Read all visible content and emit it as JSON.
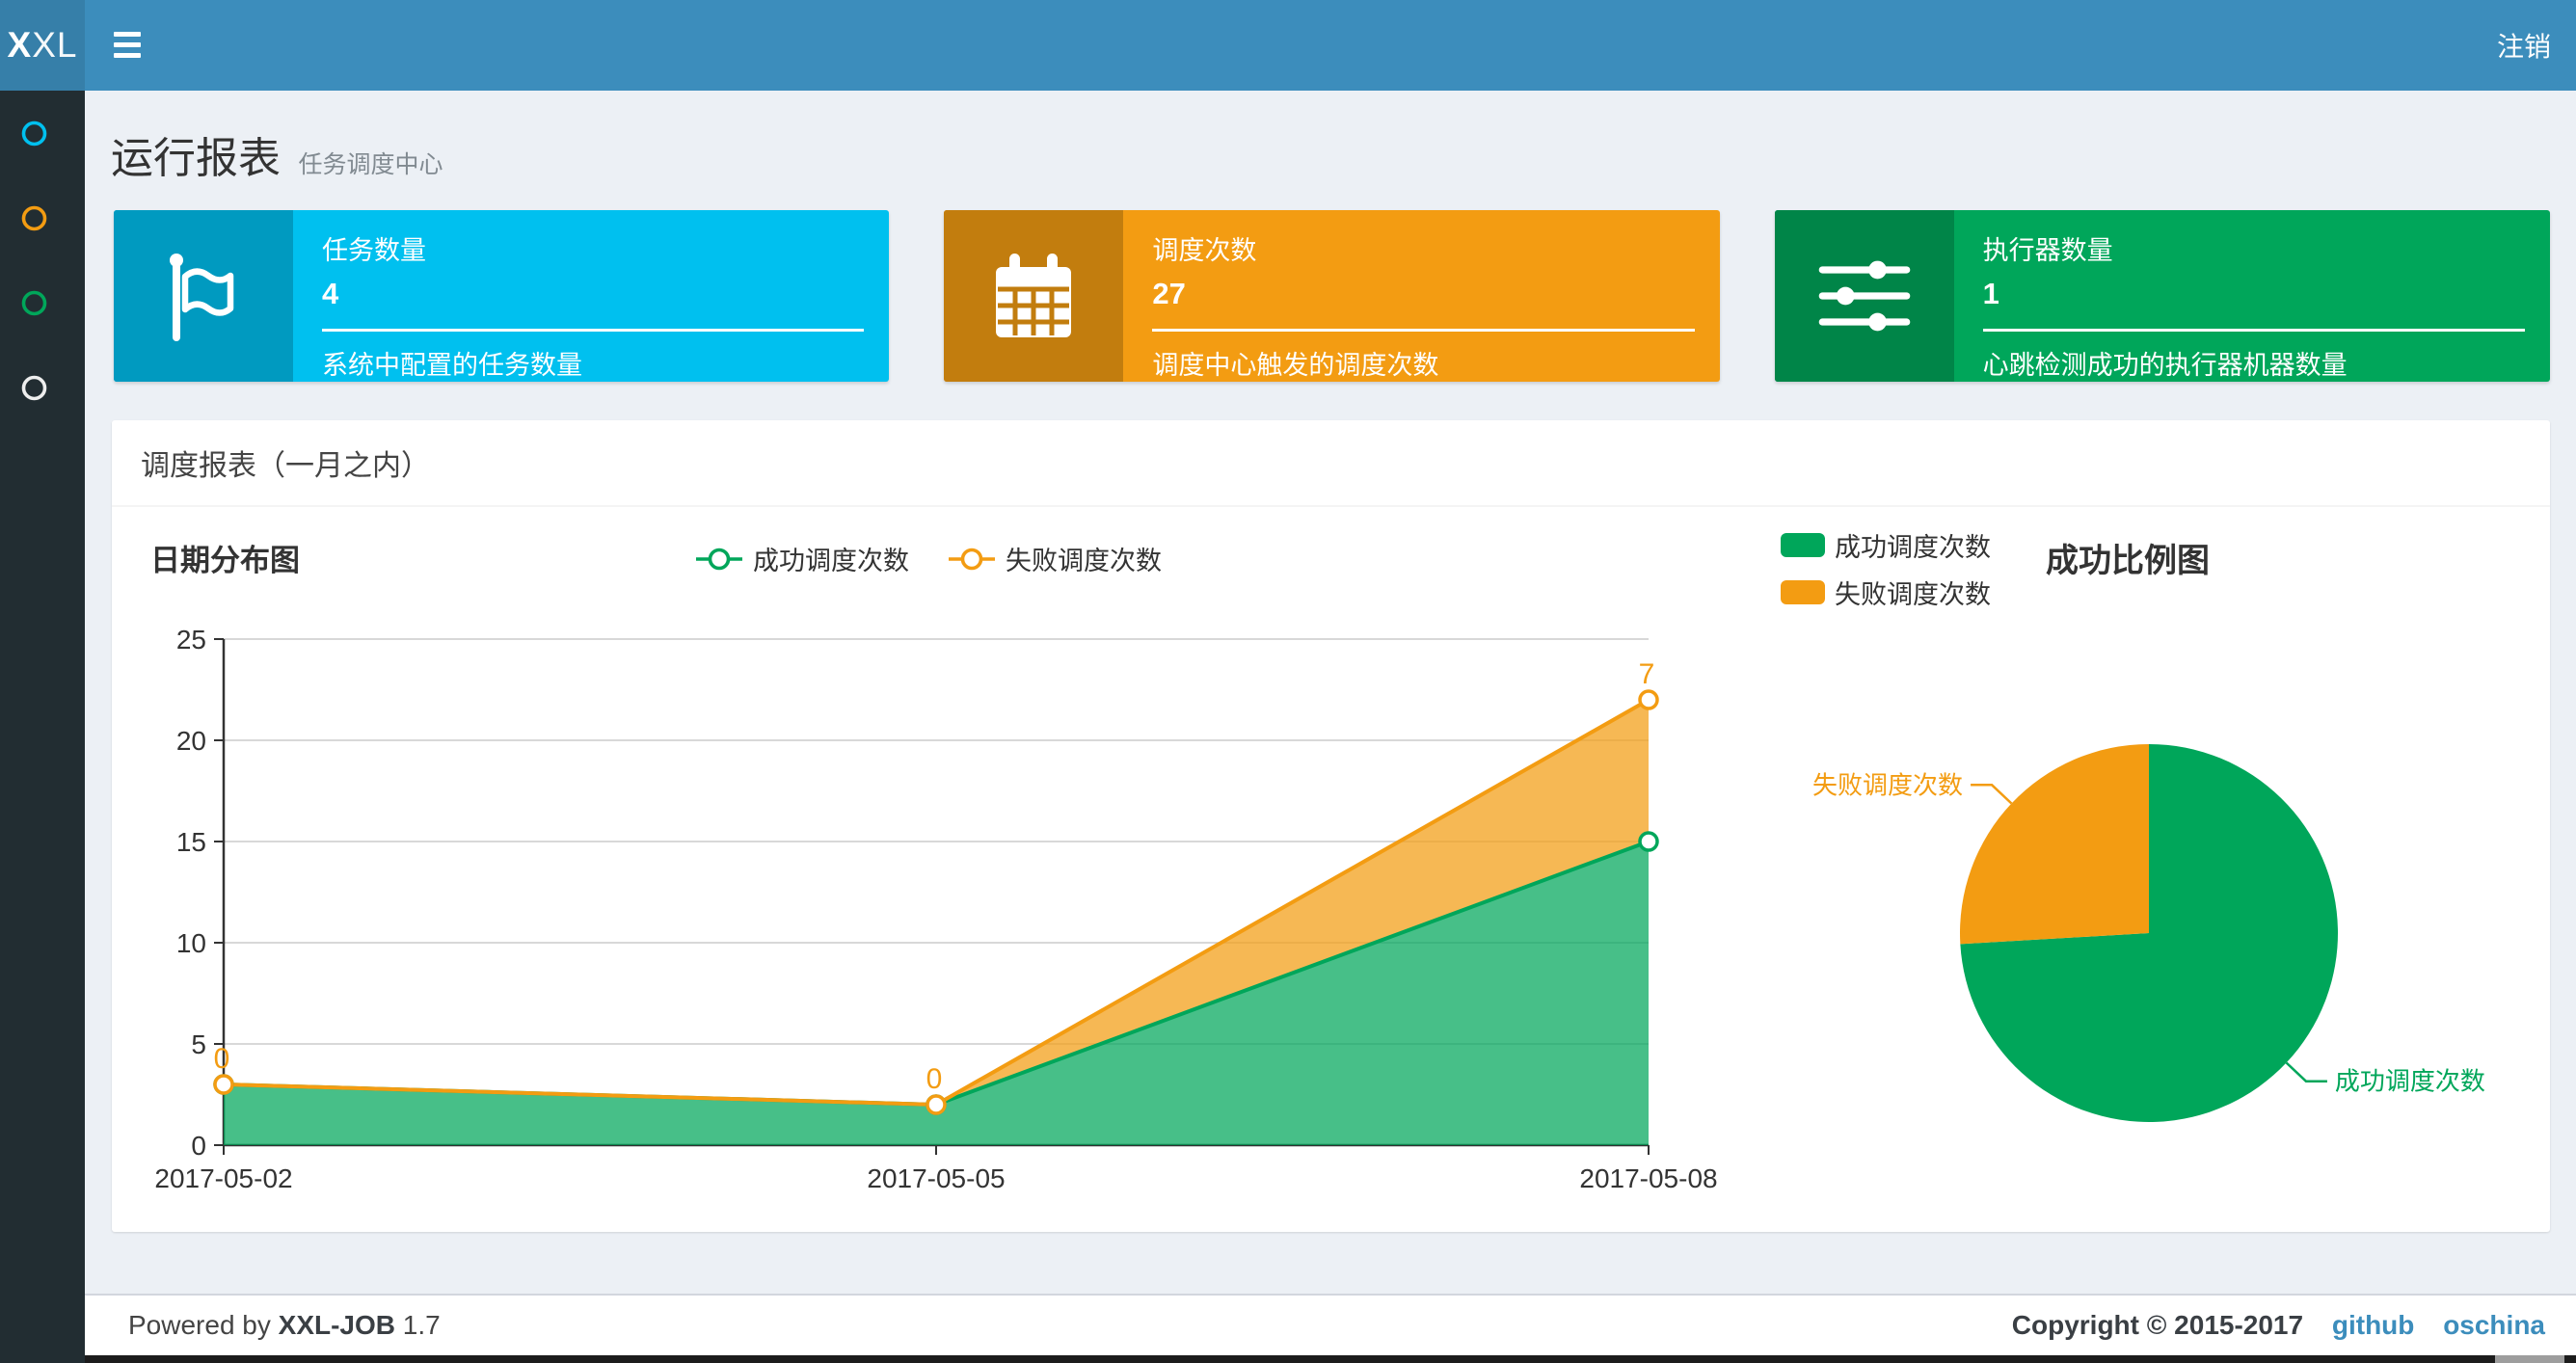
{
  "colors": {
    "navbar_bg": "#3c8dbc",
    "logo_bg": "#367fa9",
    "sidebar_bg": "#222d32",
    "content_bg": "#ecf0f5",
    "aqua": "#00c0ef",
    "aqua_dark": "#009ac0",
    "yellow": "#f39c12",
    "yellow_dark": "#c27d0e",
    "green": "#00a65a",
    "green_dark": "#008548",
    "link": "#3c8dbc",
    "footer_border": "#d2d6de"
  },
  "navbar": {
    "logo_bold": "X",
    "logo_rest": "XL",
    "logout_label": "注销"
  },
  "sidebar": {
    "items": [
      {
        "icon": "circle-icon",
        "color": "#00c0ef"
      },
      {
        "icon": "circle-icon",
        "color": "#f39c12"
      },
      {
        "icon": "circle-icon",
        "color": "#00a65a"
      },
      {
        "icon": "circle-icon",
        "color": "#eeeeee"
      }
    ]
  },
  "page_header": {
    "title": "运行报表",
    "subtitle": "任务调度中心"
  },
  "info_boxes": [
    {
      "label": "任务数量",
      "value": "4",
      "description": "系统中配置的任务数量",
      "icon": "flag-icon",
      "color": "#00c0ef"
    },
    {
      "label": "调度次数",
      "value": "27",
      "description": "调度中心触发的调度次数",
      "icon": "calendar-icon",
      "color": "#f39c12"
    },
    {
      "label": "执行器数量",
      "value": "1",
      "description": "心跳检测成功的执行器机器数量",
      "icon": "sliders-icon",
      "color": "#00a65a"
    }
  ],
  "panel": {
    "title": "调度报表（一月之内）"
  },
  "chart_data": [
    {
      "type": "area",
      "title": "日期分布图",
      "x": [
        "2017-05-02",
        "2017-05-05",
        "2017-05-08"
      ],
      "series": [
        {
          "name": "成功调度次数",
          "values": [
            3,
            2,
            15
          ],
          "color": "#00A65A",
          "show_labels": false
        },
        {
          "name": "失败调度次数",
          "values": [
            0,
            0,
            7
          ],
          "color": "#F39C12",
          "show_labels": true,
          "labels": [
            "0",
            "0",
            "7"
          ]
        }
      ],
      "stacked": true,
      "ylim": [
        0,
        25
      ],
      "yticks": [
        0,
        5,
        10,
        15,
        20,
        25
      ],
      "grid": true,
      "legend_position": "top-center",
      "marker": "empty-circle"
    },
    {
      "type": "pie",
      "title": "成功比例图",
      "slices": [
        {
          "name": "成功调度次数",
          "value": 20,
          "color": "#00A65A"
        },
        {
          "name": "失败调度次数",
          "value": 7,
          "color": "#F39C12"
        }
      ],
      "start_angle": "top",
      "direction": "clockwise",
      "legend_position": "top-left"
    }
  ],
  "footer": {
    "powered_prefix": "Powered by",
    "product": "XXL-JOB",
    "version": "1.7",
    "copyright": "Copyright © 2015-2017",
    "links": [
      {
        "label": "github"
      },
      {
        "label": "oschina"
      }
    ]
  }
}
